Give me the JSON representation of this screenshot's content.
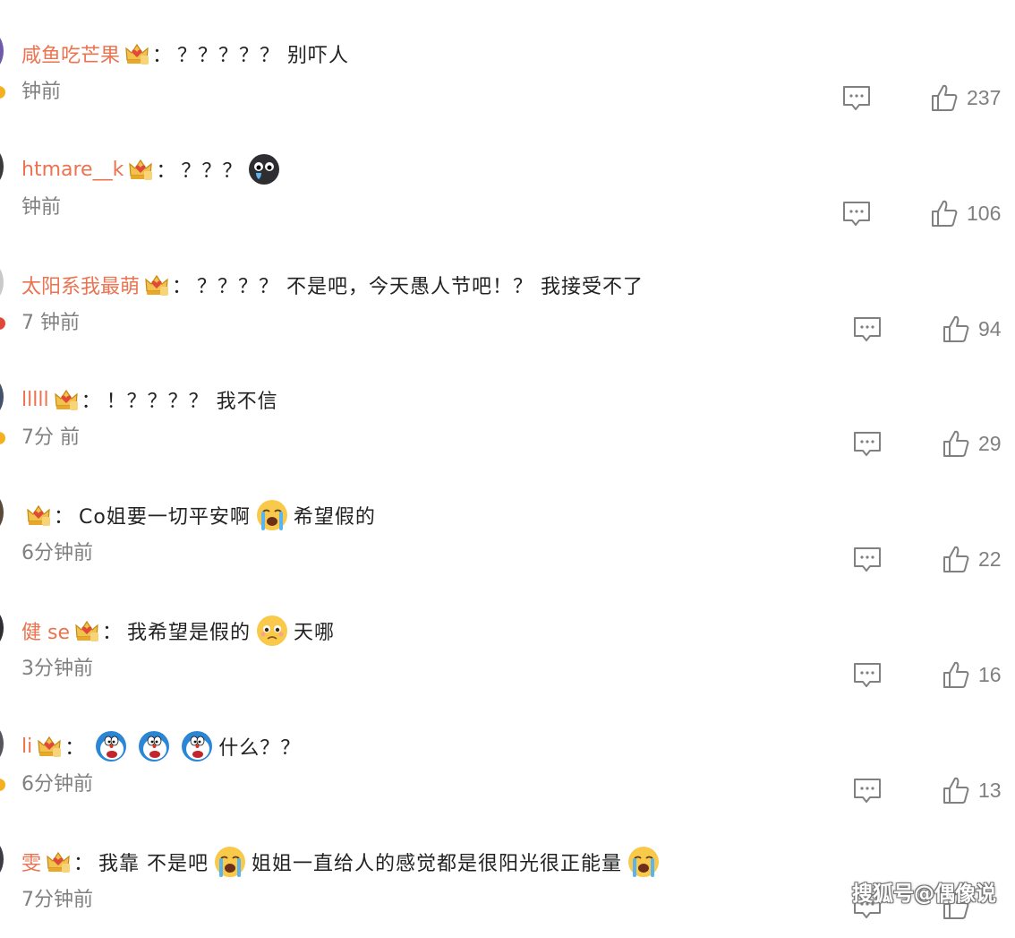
{
  "comments": [
    {
      "username": "咸鱼吃芒果",
      "text": "？？？？？ 别吓人",
      "time": "钟前",
      "likes": "237",
      "emojis": []
    },
    {
      "username": "htmare__k",
      "text": "？？？",
      "time": "钟前",
      "likes": "106",
      "emojis": [
        {
          "name": "black-face-emoji",
          "after": ""
        }
      ]
    },
    {
      "username": "太阳系我最萌",
      "text": "？？？？ 不是吧，今天愚人节吧！？ 我接受不了",
      "time": "7 钟前",
      "likes": "94",
      "emojis": []
    },
    {
      "username": "lllll",
      "text": "！？？？？ 我不信",
      "time": "7分 前",
      "likes": "29",
      "emojis": []
    },
    {
      "username": "",
      "text": "Co姐要一切平安啊",
      "time": "6分钟前",
      "likes": "22",
      "emojis": [
        {
          "name": "crying-emoji",
          "after": "希望假的"
        }
      ]
    },
    {
      "username": "健 se",
      "text": "我希望是假的",
      "time": "3分钟前",
      "likes": "16",
      "emojis": [
        {
          "name": "pleading-emoji",
          "after": "天哪"
        }
      ]
    },
    {
      "username": "li",
      "text": "",
      "time": "6分钟前",
      "likes": "13",
      "emojis": [
        {
          "name": "doraemon-emoji",
          "after": ""
        },
        {
          "name": "doraemon-emoji",
          "after": ""
        },
        {
          "name": "doraemon-emoji",
          "after": "什么？？"
        }
      ]
    },
    {
      "username": "雯",
      "text": "我靠 不是吧",
      "time": "7分钟前",
      "likes": "",
      "emojis": [
        {
          "name": "crying-emoji",
          "after": "姐姐一直给人的感觉都是很阳光很正能量"
        },
        {
          "name": "crying-emoji",
          "after": ""
        }
      ]
    }
  ],
  "watermark": "搜狐号@偶像说",
  "colors": {
    "username": "#eb7350",
    "text": "#222222",
    "meta": "#808080",
    "crown": "#e0483a"
  }
}
